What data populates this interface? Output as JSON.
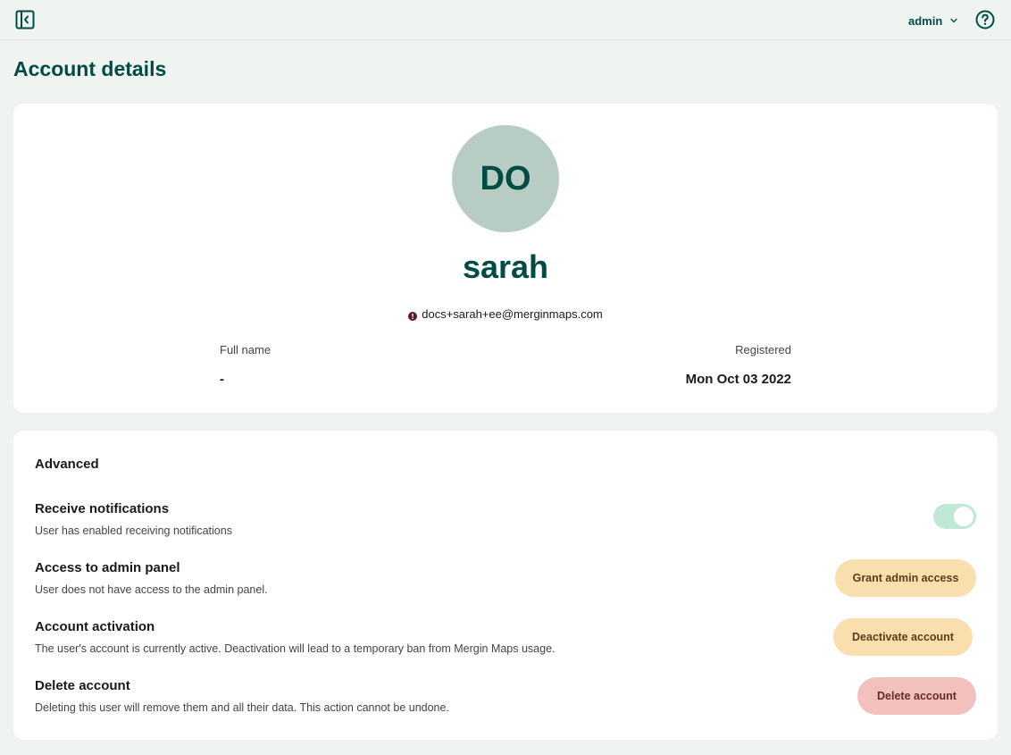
{
  "topbar": {
    "user_label": "admin"
  },
  "page": {
    "title": "Account details"
  },
  "profile": {
    "initials": "DO",
    "username": "sarah",
    "email": "docs+sarah+ee@merginmaps.com",
    "full_name_label": "Full name",
    "full_name_value": "-",
    "registered_label": "Registered",
    "registered_value": "Mon Oct 03 2022"
  },
  "advanced": {
    "heading": "Advanced",
    "notifications": {
      "title": "Receive notifications",
      "description": "User has enabled receiving notifications",
      "enabled": true
    },
    "admin_panel": {
      "title": "Access to admin panel",
      "description": "User does not have access to the admin panel.",
      "button_label": "Grant admin access"
    },
    "activation": {
      "title": "Account activation",
      "description": "The user's account is currently active. Deactivation will lead to a temporary ban from Mergin Maps usage.",
      "button_label": "Deactivate account"
    },
    "delete": {
      "title": "Delete account",
      "description": "Deleting this user will remove them and all their data. This action cannot be undone.",
      "button_label": "Delete account"
    }
  },
  "colors": {
    "brand": "#004c45",
    "background": "#eff4f1",
    "avatar": "#b7cdc4",
    "toggle_on": "#bfe8d6",
    "warning_button": "#f9dfad",
    "danger_button": "#f2c1be"
  },
  "icons": {
    "sidebar_toggle": "sidebar-collapse-icon",
    "user_menu": "chevron-down-icon",
    "help": "help-circle-icon",
    "email_status": "warning-icon"
  }
}
